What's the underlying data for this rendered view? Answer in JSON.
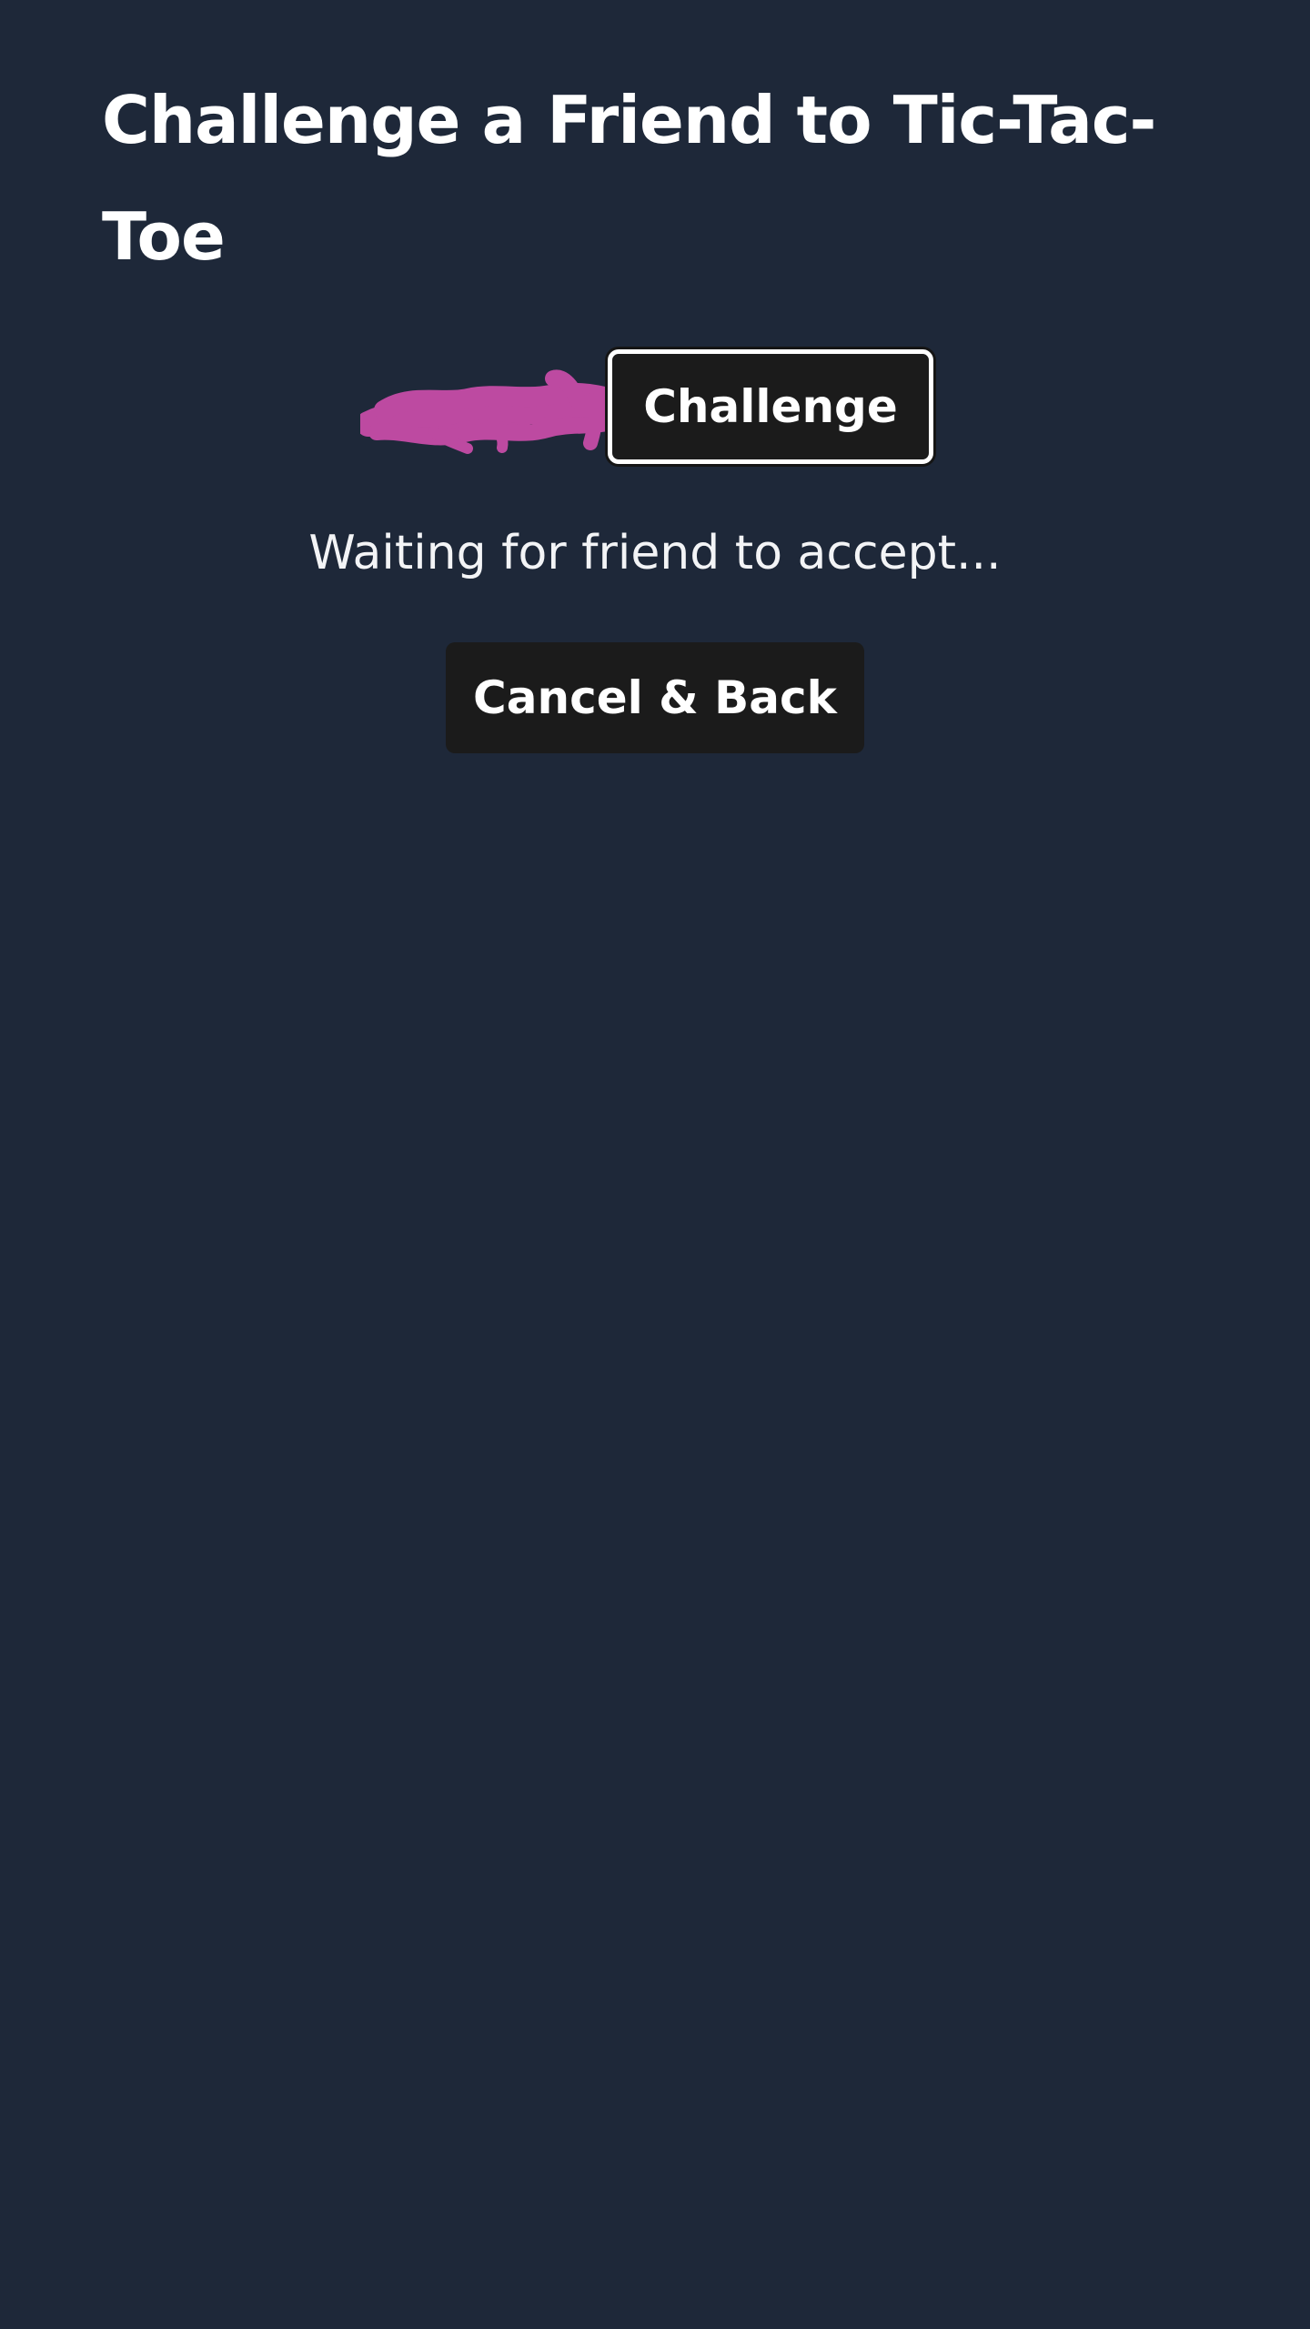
{
  "page": {
    "title": "Challenge a Friend to Tic-Tac-Toe",
    "background_color": "#1e2839"
  },
  "challenge": {
    "button_label": "Challenge",
    "redaction_color": "#bd4aa1"
  },
  "status": {
    "text": "Waiting for friend to accept..."
  },
  "actions": {
    "cancel_label": "Cancel & Back"
  }
}
